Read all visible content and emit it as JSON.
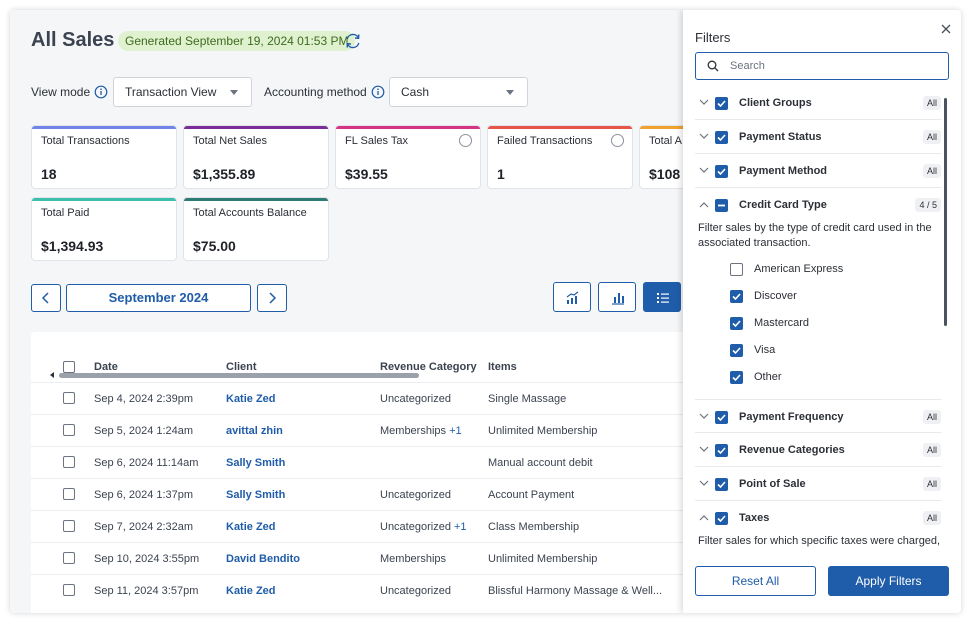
{
  "header": {
    "title": "All Sales",
    "generated": "Generated September 19, 2024 01:53 PM"
  },
  "controls": {
    "view_mode_label": "View mode",
    "view_mode_value": "Transaction View",
    "accounting_label": "Accounting method",
    "accounting_value": "Cash"
  },
  "cards": [
    {
      "label": "Total Transactions",
      "value": "18",
      "color": "#6f86e8"
    },
    {
      "label": "Total Net Sales",
      "value": "$1,355.89",
      "color": "#7b2d9a"
    },
    {
      "label": "FL Sales Tax",
      "value": "$39.55",
      "color": "#d63384"
    },
    {
      "label": "Failed Transactions",
      "value": "1",
      "color": "#e8534a"
    },
    {
      "label": "Total A",
      "value": "$108",
      "color": "#f0a22e"
    },
    {
      "label": "Total Paid",
      "value": "$1,394.93",
      "color": "#3cbfae"
    },
    {
      "label": "Total Accounts Balance",
      "value": "$75.00",
      "color": "#2e7b74"
    }
  ],
  "month_nav": {
    "label": "September 2024"
  },
  "table": {
    "headers": [
      "Date",
      "Client",
      "Revenue Category",
      "Items"
    ],
    "rows": [
      {
        "date": "Sep 4, 2024  2:39pm",
        "client": "Katie Zed",
        "category": "Uncategorized",
        "plus": "",
        "items": "Single Massage"
      },
      {
        "date": "Sep 5, 2024  1:24am",
        "client": "avittal zhin",
        "category": "Memberships",
        "plus": "+1",
        "items": "Unlimited Membership"
      },
      {
        "date": "Sep 6, 2024  11:14am",
        "client": "Sally Smith",
        "category": "",
        "plus": "",
        "items": "Manual account debit"
      },
      {
        "date": "Sep 6, 2024  1:37pm",
        "client": "Sally Smith",
        "category": "Uncategorized",
        "plus": "",
        "items": "Account Payment"
      },
      {
        "date": "Sep 7, 2024  2:32am",
        "client": "Katie Zed",
        "category": "Uncategorized",
        "plus": "+1",
        "items": "Class Membership"
      },
      {
        "date": "Sep 10, 2024  3:55pm",
        "client": "David Bendito",
        "category": "Memberships",
        "plus": "",
        "items": "Unlimited Membership"
      },
      {
        "date": "Sep 11, 2024  3:57pm",
        "client": "Katie Zed",
        "category": "Uncategorized",
        "plus": "",
        "items": "Blissful Harmony Massage & Well..."
      }
    ]
  },
  "filters": {
    "title": "Filters",
    "search_placeholder": "Search",
    "groups": [
      {
        "name": "Client Groups",
        "badge": "All"
      },
      {
        "name": "Payment Status",
        "badge": "All"
      },
      {
        "name": "Payment Method",
        "badge": "All"
      },
      {
        "name": "Credit Card Type",
        "badge": "4 / 5"
      },
      {
        "name": "Payment Frequency",
        "badge": "All"
      },
      {
        "name": "Revenue Categories",
        "badge": "All"
      },
      {
        "name": "Point of Sale",
        "badge": "All"
      },
      {
        "name": "Taxes",
        "badge": "All"
      }
    ],
    "credit_card_desc": "Filter sales by the type of credit card used in the associated transaction.",
    "credit_card_options": [
      {
        "label": "American Express",
        "checked": false
      },
      {
        "label": "Discover",
        "checked": true
      },
      {
        "label": "Mastercard",
        "checked": true
      },
      {
        "label": "Visa",
        "checked": true
      },
      {
        "label": "Other",
        "checked": true
      }
    ],
    "taxes_desc": "Filter sales for which specific taxes were charged,",
    "reset_label": "Reset All",
    "apply_label": "Apply Filters"
  },
  "colors": {
    "primary": "#1f5ca9"
  }
}
